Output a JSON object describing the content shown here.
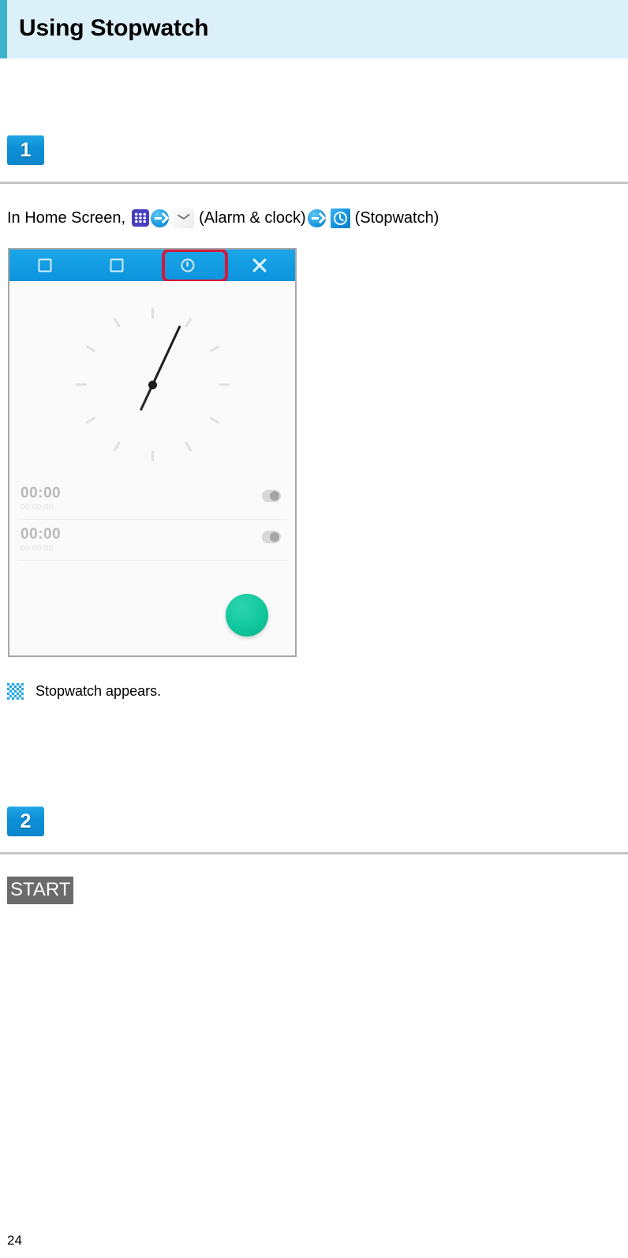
{
  "header": {
    "title": "Using Stopwatch",
    "accent_color": "#3eb3cd",
    "background_color": "#dcf0fa"
  },
  "steps": [
    {
      "badge": "1",
      "instruction": {
        "prefix": "In Home Screen,",
        "apps_icon": "apps-grid-icon",
        "arrow_icon_1": "arrow-right-circle-icon",
        "clock_icon": "alarm-clock-icon",
        "alarm_clock_label": "(Alarm & clock)",
        "arrow_icon_2": "arrow-right-circle-icon",
        "stopwatch_icon": "stopwatch-icon",
        "stopwatch_label": "(Stopwatch)"
      },
      "screenshot": {
        "name": "stopwatch-screen-capture",
        "navbar_tabs": [
          {
            "name": "tab-alarm",
            "icon": "alarm-icon"
          },
          {
            "name": "tab-world-clock",
            "icon": "world-clock-icon"
          },
          {
            "name": "tab-stopwatch",
            "icon": "stopwatch-icon",
            "highlighted": true
          },
          {
            "name": "tab-timer",
            "icon": "timer-icon"
          }
        ],
        "highlight_color": "#d31a3c",
        "lap_rows": [
          {
            "time": "00:00",
            "sub": "00:00:00"
          },
          {
            "time": "00:00",
            "sub": "00:00:00"
          }
        ],
        "fab": {
          "name": "start-fab",
          "color": "#10c79b"
        }
      },
      "result_note": "Stopwatch appears.",
      "result_bullet_icon": "checker-bullet-icon"
    },
    {
      "badge": "2",
      "key_label": "START",
      "key_label_background": "#6b6b6b"
    }
  ],
  "footer": {
    "page_number": "24"
  }
}
